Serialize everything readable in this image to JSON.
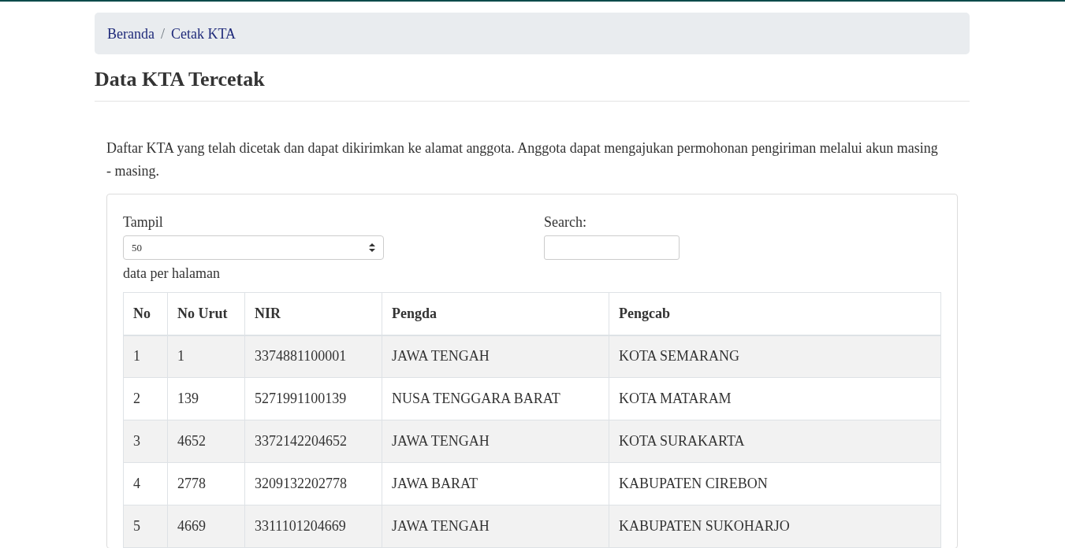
{
  "breadcrumb": [
    {
      "label": "Beranda"
    },
    {
      "label": "Cetak KTA"
    }
  ],
  "breadcrumb_separator": "/",
  "title": "Data KTA Tercetak",
  "description": "Daftar KTA yang telah dicetak dan dapat dikirimkan ke alamat anggota. Anggota dapat mengajukan permohonan pengiriman melalui akun masing - masing.",
  "length_control": {
    "label": "Tampil",
    "value": "50",
    "suffix": "data per halaman"
  },
  "search": {
    "label": "Search:"
  },
  "table": {
    "columns": [
      "No",
      "No Urut",
      "NIR",
      "Pengda",
      "Pengcab"
    ],
    "rows": [
      [
        "1",
        "1",
        "3374881100001",
        "JAWA TENGAH",
        "KOTA SEMARANG"
      ],
      [
        "2",
        "139",
        "5271991100139",
        "NUSA TENGGARA BARAT",
        "KOTA MATARAM"
      ],
      [
        "3",
        "4652",
        "3372142204652",
        "JAWA TENGAH",
        "KOTA SURAKARTA"
      ],
      [
        "4",
        "2778",
        "3209132202778",
        "JAWA BARAT",
        "KABUPATEN CIREBON"
      ],
      [
        "5",
        "4669",
        "3311101204669",
        "JAWA TENGAH",
        "KABUPATEN SUKOHARJO"
      ]
    ]
  }
}
